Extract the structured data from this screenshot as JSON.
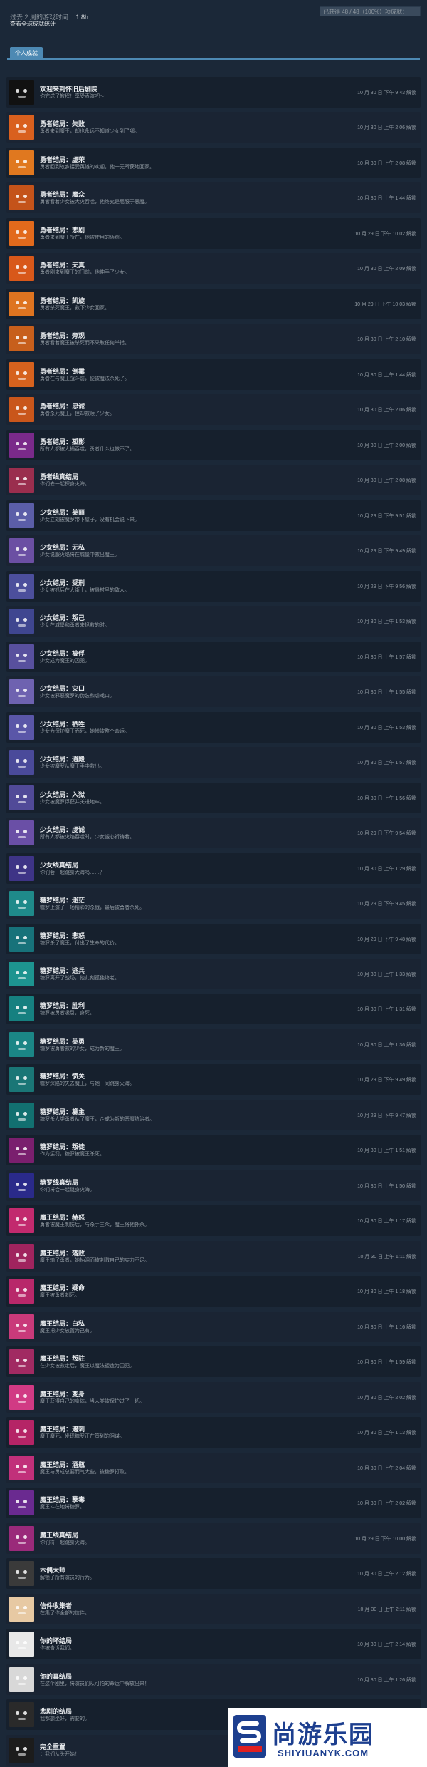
{
  "header": {
    "playtime_label": "过去 2 周的游戏时间",
    "playtime_hours": "1.8h",
    "view_global_stats": "查看全球成就统计",
    "progress_text": "已获得 48 / 48（100%）项成就：",
    "progress_fraction": 1.0
  },
  "tabs": [
    {
      "label": "个人成就"
    }
  ],
  "achievements": [
    {
      "title": "欢迎来到怀旧后剧院",
      "desc": "你完成了教程！享受表演吧～",
      "date": "10 月 30 日 下午 9:43 解锁",
      "color": "#111111",
      "icon": "welcome-icon"
    },
    {
      "title": "勇者结局：失败",
      "desc": "勇者来到魔王，却也永远不知道少女到了哪。",
      "date": "10 月 30 日 上午 2:06 解锁",
      "color": "#d9601e",
      "icon": "hero-icon"
    },
    {
      "title": "勇者结局：虚荣",
      "desc": "勇者回到故乡接受英雄的欢迎，他一无所获地回家。",
      "date": "10 月 30 日 上午 2:08 解锁",
      "color": "#e0781f",
      "icon": "hero-icon"
    },
    {
      "title": "勇者结局：魔众",
      "desc": "勇者看着少女被大火吞噬，他终究是屈服于恶魔。",
      "date": "10 月 30 日 上午 1:44 解锁",
      "color": "#c4531a",
      "icon": "hero-icon"
    },
    {
      "title": "勇者结局：悲剧",
      "desc": "勇者来到魔王所在，他被使用的惩罚。",
      "date": "10 月 29 日 下午 10:02 解锁",
      "color": "#e26a1c",
      "icon": "hero-icon"
    },
    {
      "title": "勇者结局：天真",
      "desc": "勇者刚来到魔王的门前，他伸手了少女。",
      "date": "10 月 30 日 上午 2:09 解锁",
      "color": "#d8581a",
      "icon": "hero-icon"
    },
    {
      "title": "勇者结局：凯旋",
      "desc": "勇者杀死魔王，救下少女回家。",
      "date": "10 月 29 日 下午 10:03 解锁",
      "color": "#de7420",
      "icon": "hero-icon"
    },
    {
      "title": "勇者结局：旁观",
      "desc": "勇者看着魔王被杀死而不采取任何举措。",
      "date": "10 月 30 日 上午 2:10 解锁",
      "color": "#c75f1c",
      "icon": "hero-icon"
    },
    {
      "title": "勇者结局：倒霉",
      "desc": "勇者在与魔王战斗前，便被魔法杀死了。",
      "date": "10 月 30 日 上午 1:44 解锁",
      "color": "#d6621e",
      "icon": "hero-icon"
    },
    {
      "title": "勇者结局：忠诚",
      "desc": "勇者杀死魔王，但却救赎了少女。",
      "date": "10 月 30 日 上午 2:06 解锁",
      "color": "#c9561b",
      "icon": "hero-icon"
    },
    {
      "title": "勇者结局：孤影",
      "desc": "所有人都被大祸吞噬，勇者什么也做不了。",
      "date": "10 月 30 日 上午 2:00 解锁",
      "color": "#7a2a8a",
      "icon": "hero-icon"
    },
    {
      "title": "勇者线真结局",
      "desc": "你们去一起探身火海。",
      "date": "10 月 30 日 上午 2:08 解锁",
      "color": "#9a2e4e",
      "icon": "hero-icon"
    },
    {
      "title": "少女结局：美丽",
      "desc": "少女立刻被魔罗带下屋子，没有机会说下来。",
      "date": "10 月 29 日 下午 9:51 解锁",
      "color": "#5b5ea8",
      "icon": "girl-icon"
    },
    {
      "title": "少女结局：无私",
      "desc": "少女说服火焰将在城堡中救出魔王。",
      "date": "10 月 29 日 下午 9:49 解锁",
      "color": "#6b4fa3",
      "icon": "girl-icon"
    },
    {
      "title": "少女结局：受刑",
      "desc": "少女被抓后在大街上，被愚村里的敌人。",
      "date": "10 月 29 日 下午 9:56 解锁",
      "color": "#4c4f9c",
      "icon": "girl-icon"
    },
    {
      "title": "少女结局：叛己",
      "desc": "少女在城堡和勇者来拯救的时。",
      "date": "10 月 30 日 上午 1:53 解锁",
      "color": "#3f4690",
      "icon": "girl-icon"
    },
    {
      "title": "少女结局：被俘",
      "desc": "少女成为魔王的囚犯。",
      "date": "10 月 30 日 上午 1:57 解锁",
      "color": "#58509e",
      "icon": "girl-icon"
    },
    {
      "title": "少女结局：灾口",
      "desc": "少女被邪恶魔罗的伪装和虐戏口。",
      "date": "10 月 30 日 上午 1:55 解锁",
      "color": "#6e62b0",
      "icon": "girl-icon"
    },
    {
      "title": "少女结局：牺牲",
      "desc": "少女为保护魔王而死，她惨被整个命运。",
      "date": "10 月 30 日 上午 1:53 解锁",
      "color": "#5a56a8",
      "icon": "girl-icon"
    },
    {
      "title": "少女结局：逍殿",
      "desc": "少女被魔罗从魔王手中救出。",
      "date": "10 月 30 日 上午 1:57 解锁",
      "color": "#4a4a9a",
      "icon": "girl-icon"
    },
    {
      "title": "少女结局：入狱",
      "desc": "少女被魔罗俘获并关进地牢。",
      "date": "10 月 30 日 上午 1:56 解锁",
      "color": "#514a98",
      "icon": "girl-icon"
    },
    {
      "title": "少女结局：虔诚",
      "desc": "所有人都被火焰吞噬时，少女诚心祈祷着。",
      "date": "10 月 29 日 下午 9:54 解锁",
      "color": "#6a4fa6",
      "icon": "girl-icon"
    },
    {
      "title": "少女线真结局",
      "desc": "你们会一起跳身大海吗……？",
      "date": "10 月 30 日 上午 1:29 解锁",
      "color": "#3e3486",
      "icon": "girl-icon"
    },
    {
      "title": "糖罗结局：迷茫",
      "desc": "糖罗上演了一场精彩的杀戮，最后被勇者杀死。",
      "date": "10 月 29 日 下午 9:45 解锁",
      "color": "#1f8a8a",
      "icon": "tangluo-icon"
    },
    {
      "title": "糖罗结局：悲怒",
      "desc": "糖罗杀了魔王，付出了生命的代价。",
      "date": "10 月 29 日 下午 9:48 解锁",
      "color": "#17727a",
      "icon": "tangluo-icon"
    },
    {
      "title": "糖罗结局：逃兵",
      "desc": "糖罗离开了战场，他此刻孤独终老。",
      "date": "10 月 30 日 上午 1:33 解锁",
      "color": "#1d9490",
      "icon": "tangluo-icon"
    },
    {
      "title": "糖罗结局：胜利",
      "desc": "糖罗被勇者吸引，身死。",
      "date": "10 月 30 日 上午 1:31 解锁",
      "color": "#168080",
      "icon": "tangluo-icon"
    },
    {
      "title": "糖罗结局：英勇",
      "desc": "糖罗被勇者救的少女，成为新的魔王。",
      "date": "10 月 30 日 上午 1:36 解锁",
      "color": "#1b8686",
      "icon": "tangluo-icon"
    },
    {
      "title": "糖罗结局：愤关",
      "desc": "糖罗深陷的失去魔王，与她一同跳身火海。",
      "date": "10 月 29 日 下午 9:49 解锁",
      "color": "#1a7676",
      "icon": "tangluo-icon"
    },
    {
      "title": "糖罗结局：篡主",
      "desc": "糖罗杀人类勇者从了魔王，企成为新的恶魔统治者。",
      "date": "10 月 29 日 下午 9:47 解锁",
      "color": "#127070",
      "icon": "tangluo-icon"
    },
    {
      "title": "糖罗结局：叛徒",
      "desc": "作为惩罚，糖罗被魔王杀死。",
      "date": "10 月 30 日 上午 1:51 解锁",
      "color": "#7a1f6e",
      "icon": "tangluo-icon"
    },
    {
      "title": "糖罗线真结局",
      "desc": "你们将会一起跳身火海。",
      "date": "10 月 30 日 上午 1:50 解锁",
      "color": "#2a2a8a",
      "icon": "tangluo-icon"
    },
    {
      "title": "魔王结局：赫怒",
      "desc": "勇者被魔王刺伤后，与杀手三众，魔王将他扑杀。",
      "date": "10 月 30 日 上午 1:17 解锁",
      "color": "#c22a6e",
      "icon": "demon-icon"
    },
    {
      "title": "魔王结局：落败",
      "desc": "魔王输了勇者，她抽泪而被刺激自己的实力不足。",
      "date": "10 月 30 日 上午 1:11 解锁",
      "color": "#a0245e",
      "icon": "demon-icon"
    },
    {
      "title": "魔王结局：疑命",
      "desc": "魔王被勇者刺死。",
      "date": "10 月 30 日 上午 1:18 解锁",
      "color": "#b8286a",
      "icon": "demon-icon"
    },
    {
      "title": "魔王结局：白私",
      "desc": "魔王把少女放置为己有。",
      "date": "10 月 30 日 上午 1:16 解锁",
      "color": "#c93a7a",
      "icon": "demon-icon"
    },
    {
      "title": "魔王结局：叛驻",
      "desc": "在少女被救走后，魔王以魔法塑造为囚犯。",
      "date": "10 月 30 日 上午 1:59 解锁",
      "color": "#a12a62",
      "icon": "demon-icon"
    },
    {
      "title": "魔王结局：变身",
      "desc": "魔王获得自己的身体，当人类被保护过了一切。",
      "date": "10 月 30 日 上午 2:02 解锁",
      "color": "#d13a84",
      "icon": "demon-icon"
    },
    {
      "title": "魔王结局：遇刺",
      "desc": "魔王魔死，发现糖罗正在策划的阴谋。",
      "date": "10 月 30 日 上午 1:13 解锁",
      "color": "#b52466",
      "icon": "demon-icon"
    },
    {
      "title": "魔王结局：酒瓶",
      "desc": "魔王与勇成总要而气大些，被糖罗打败。",
      "date": "10 月 30 日 上午 2:04 解锁",
      "color": "#c1307a",
      "icon": "demon-icon"
    },
    {
      "title": "魔王结局：孽毒",
      "desc": "魔王斗在地将糖罗。",
      "date": "10 月 30 日 上午 2:02 解锁",
      "color": "#6a2a90",
      "icon": "demon-icon"
    },
    {
      "title": "魔王线真结局",
      "desc": "你们将一起跳身火海。",
      "date": "10 月 29 日 下午 10:00 解锁",
      "color": "#9a2a7a",
      "icon": "demon-icon"
    },
    {
      "title": "木偶大师",
      "desc": "解锁了所有演员的行为。",
      "date": "10 月 30 日 上午 2:12 解锁",
      "color": "#3a3a3a",
      "icon": "puppet-icon"
    },
    {
      "title": "信件收集者",
      "desc": "在集了你全部的信件。",
      "date": "10 月 30 日 上午 2:11 解锁",
      "color": "#e7c9a3",
      "icon": "letter-icon"
    },
    {
      "title": "你的坏结局",
      "desc": "你被告诉我们。",
      "date": "10 月 30 日 上午 2:14 解锁",
      "color": "#e8e8e8",
      "icon": "bad-end-icon"
    },
    {
      "title": "你的真结局",
      "desc": "在这个剧里，将演员们从可怕的命运中解放出来！",
      "date": "10 月 30 日 上午 1:26 解锁",
      "color": "#d8d8d8",
      "icon": "true-end-icon"
    },
    {
      "title": "悲剧的结局",
      "desc": "我都想坐好，需要的。",
      "date": "10 月 30 日 上午 1:28 解锁",
      "color": "#2a2a2a",
      "icon": "tragic-end-icon"
    },
    {
      "title": "完全重置",
      "desc": "让我们从头开始！",
      "date": "",
      "color": "#1c1c1c",
      "icon": "reset-icon"
    }
  ],
  "watermark": {
    "title": "尚游乐园",
    "sub": "SHIYIUANYK.COM"
  }
}
